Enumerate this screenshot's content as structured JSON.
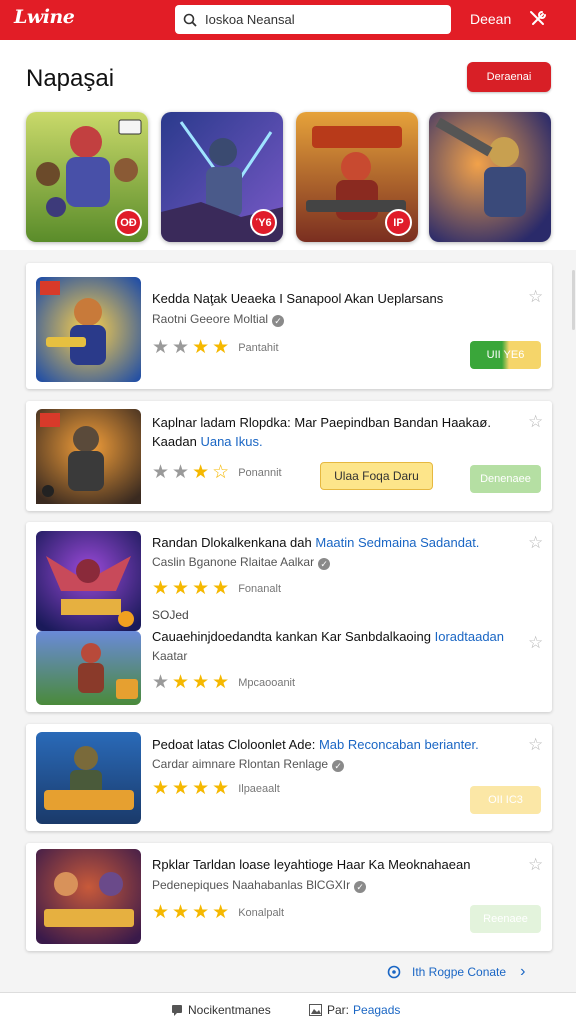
{
  "topbar": {
    "logo": "Lwine",
    "search_value": "Ioskoa Neansal",
    "right_label": "Deean",
    "brand_color": "#e21d26"
  },
  "header": {
    "title": "Napaşai",
    "button_label": "Deraenai"
  },
  "featured": [
    {
      "badge": "OĐ"
    },
    {
      "badge": "Ύ6"
    },
    {
      "badge": "ΙΡ"
    },
    {
      "badge": ""
    }
  ],
  "list": [
    {
      "title": "Kedda Naţak Ueaeka I Sanapool Akan Ueplarsans",
      "title_link": "",
      "subtitle": "Raotni Geeore Moltial",
      "rating": 4,
      "rating_text": "Pantahit",
      "button": "UII YE6"
    },
    {
      "title": "Kaplnar ladam Rlopdka: Mar Paepindban Bandan Haakaø.",
      "title_line2": "Kaadan",
      "title_link": "Uana Ikus.",
      "rating": 4,
      "rating_text": "Ponannit",
      "button_yellow": "Ulaa Foqa Daru",
      "button": "Denenaee"
    },
    {
      "title": "Randan Dlokalkenkana dah",
      "title_link": "Maatin Sedmaina Sadandat.",
      "subtitle": "Caslin Bganone Rlaitae Aalkar",
      "rating": 4,
      "rating_text": "Fonanalt",
      "extra_label": "SOJed",
      "extra_title": "Cauaehinjdoedandta kankan Kar Sanbdalkaoing",
      "extra_link": "Ioradtaadan",
      "extra_line2": "Kaatar",
      "extra_rating": 4,
      "extra_rating_text": "Mpcaooanit"
    },
    {
      "title": "Pedoat latas Cloloonlet Ade:",
      "title_link": "Mab Reconcaban berianter.",
      "subtitle": "Cardar aimnare Rlontan Renlage",
      "rating": 4,
      "rating_text": "Ilpaeaalt",
      "button": "OII IC3"
    },
    {
      "title": "Rpklar Tarldan loase leyahtioge Haar Ka Meoknahaean",
      "title_link": "",
      "subtitle": "Pedenepiques Naahabanlas BlCGXIr",
      "rating": 4,
      "rating_text": "Konalpalt",
      "button": "Reenaee"
    }
  ],
  "footer": {
    "link": "Ith Rogpe Conate"
  },
  "bottom": {
    "item1": "Nocikentmanes",
    "item2_prefix": "Par:",
    "item2_link": "Peagads"
  }
}
